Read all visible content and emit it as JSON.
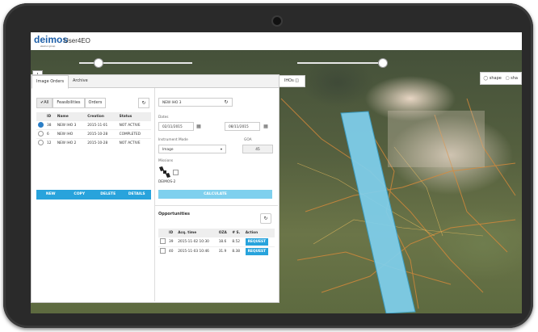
{
  "app": {
    "logo": "deimos",
    "logo_sub": "elecnor group",
    "title": "User4EO"
  },
  "map": {
    "zoom_in": "+",
    "zoom_out": "-",
    "shape_button": "shape",
    "shape_button2": "sha",
    "ihos_button": "IHOs",
    "footprint_color": "#7fd0ee"
  },
  "tabs": [
    "Image Orders",
    "Archive"
  ],
  "filters": {
    "all": "All",
    "feasibilities": "Feasibilities",
    "orders": "Orders"
  },
  "orders": {
    "columns": [
      "ID",
      "Name",
      "Creation",
      "Status"
    ],
    "rows": [
      {
        "selected": true,
        "id": "38",
        "name": "NEW IHO 3",
        "creation": "2015-11-01",
        "status": "NOT ACTIVE"
      },
      {
        "selected": false,
        "id": "6",
        "name": "NEW IHO",
        "creation": "2015-10-28",
        "status": "COMPLETED"
      },
      {
        "selected": false,
        "id": "12",
        "name": "NEW IHO 2",
        "creation": "2015-10-28",
        "status": "NOT ACTIVE"
      }
    ]
  },
  "actions": [
    "NEW",
    "COPY",
    "DELETE",
    "DETAILS"
  ],
  "form": {
    "name_value": "NEW IHO 3",
    "dates_label": "Dates",
    "date_from": "02/11/2015",
    "date_to": "08/11/2015",
    "instrument_label": "Instrument Mode",
    "instrument_value": "Image",
    "goa_label": "GOA",
    "goa_value": "45",
    "missions_label": "Missions",
    "mission_name": "DEIMOS-2",
    "calculate": "CALCULATE"
  },
  "opportunities": {
    "title": "Opportunities",
    "columns": [
      "ID",
      "Acq. time",
      "OZA",
      "# S.",
      "Action"
    ],
    "rows": [
      {
        "id": "39",
        "time": "2015-11-02 10:30",
        "oza": "18.6",
        "s": "8.52",
        "action": "REQUEST"
      },
      {
        "id": "40",
        "time": "2015-11-03 10:46",
        "oza": "31.9",
        "s": "8.38",
        "action": "REQUEST"
      }
    ]
  },
  "icons": {
    "refresh": "refresh-icon",
    "calendar": "calendar-icon",
    "satellite": "satellite-icon",
    "camera": "camera-icon"
  }
}
